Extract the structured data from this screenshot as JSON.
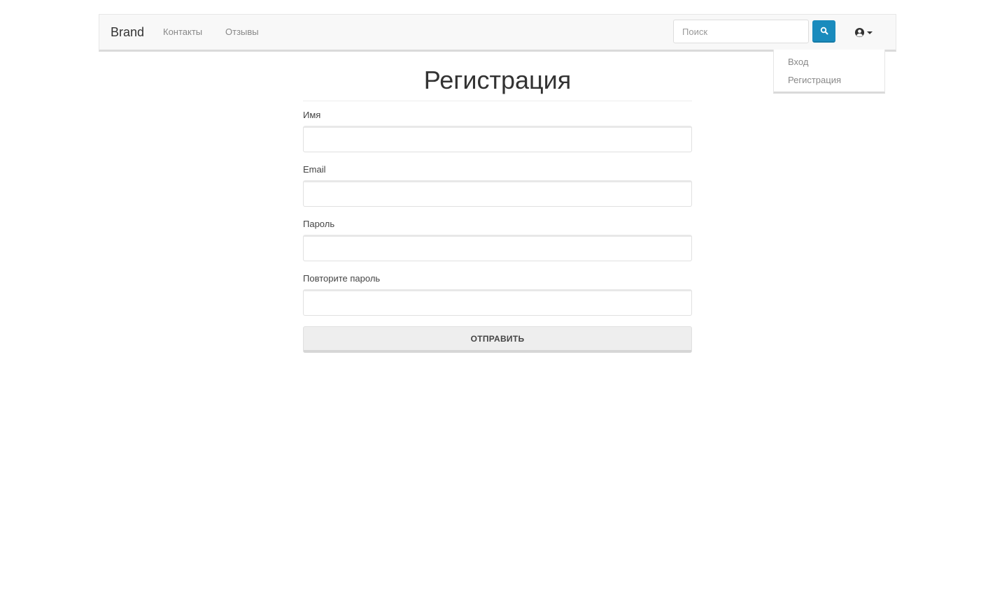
{
  "navbar": {
    "brand": "Brand",
    "links": [
      {
        "label": "Контакты"
      },
      {
        "label": "Отзывы"
      }
    ],
    "search": {
      "placeholder": "Поиск",
      "value": "",
      "button_icon": "search-icon",
      "button_color": "#1a8bbd"
    },
    "user_menu": {
      "icon": "user-circle-icon",
      "items": [
        {
          "label": "Вход"
        },
        {
          "label": "Регистрация"
        }
      ]
    }
  },
  "form": {
    "title": "Регистрация",
    "fields": [
      {
        "label": "Имя",
        "value": ""
      },
      {
        "label": "Email",
        "value": ""
      },
      {
        "label": "Пароль",
        "value": ""
      },
      {
        "label": "Повторите пароль",
        "value": ""
      }
    ],
    "submit_label": "ОТПРАВИТЬ"
  }
}
